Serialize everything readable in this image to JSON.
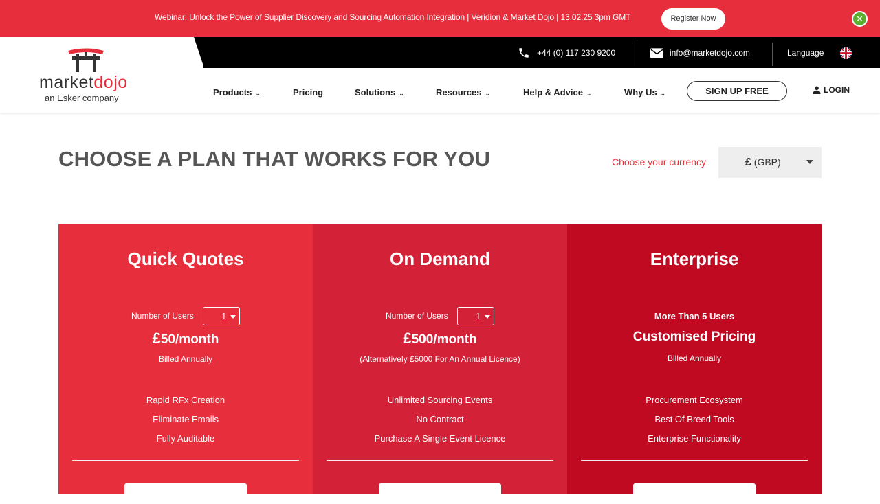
{
  "colors": {
    "brand_red": "#e62e3d",
    "plan1": "#e62e3d",
    "plan2": "#d32138",
    "plan3": "#c00a22",
    "topbar": "#000000",
    "close_green": "#5cae2e"
  },
  "banner": {
    "text": "Webinar: Unlock the Power of Supplier Discovery and Sourcing Automation Integration | Veridion & Market Dojo | 13.02.25 3pm GMT",
    "button": "Register Now",
    "close_icon": "close-icon"
  },
  "topbar": {
    "phone": "+44 (0) 117 230 9200",
    "email": "info@marketdojo.com",
    "language": "Language",
    "flag": "uk-flag-icon"
  },
  "logo": {
    "word_a": "market",
    "word_b": "dojo",
    "sub": "an Esker company"
  },
  "nav": {
    "items": [
      {
        "label": "Products",
        "dropdown": true
      },
      {
        "label": "Pricing",
        "dropdown": false
      },
      {
        "label": "Solutions",
        "dropdown": true
      },
      {
        "label": "Resources",
        "dropdown": true
      },
      {
        "label": "Help & Advice",
        "dropdown": true
      },
      {
        "label": "Why Us",
        "dropdown": true
      }
    ],
    "signup": "SIGN UP FREE",
    "login": "LOGIN"
  },
  "main": {
    "title": "CHOOSE A PLAN THAT WORKS FOR YOU",
    "currency_label": "Choose your currency",
    "currency_symbol": "£",
    "currency_code": "(GBP)"
  },
  "plans": [
    {
      "name": "Quick Quotes",
      "users_label": "Number of Users",
      "users_value": "1",
      "price_symbol": "£",
      "price_text": "50/month",
      "billed": "Billed Annually",
      "features": [
        "Rapid RFx Creation",
        "Eliminate Emails",
        "Fully Auditable"
      ]
    },
    {
      "name": "On Demand",
      "users_label": "Number of Users",
      "users_value": "1",
      "price_symbol": "£",
      "price_text": "500/month",
      "billed": "(Alternatively £5000 For An Annual Licence)",
      "features": [
        "Unlimited Sourcing Events",
        "No Contract",
        "Purchase A Single Event Licence"
      ]
    },
    {
      "name": "Enterprise",
      "users_text": "More Than 5 Users",
      "price_text": "Customised Pricing",
      "billed": "Billed Annually",
      "features": [
        "Procurement Ecosystem",
        "Best Of Breed Tools",
        "Enterprise Functionality"
      ]
    }
  ]
}
